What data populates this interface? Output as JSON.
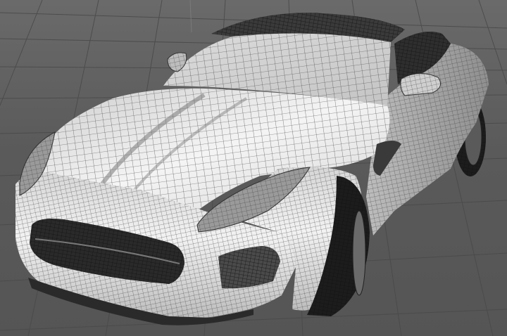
{
  "viewport": {
    "background_color": "#5d5d5d",
    "grid_color": "#474747",
    "mesh_line_color": "#3a3a3a",
    "surface_light": "#efefef",
    "surface_dark": "#9a9a9a",
    "glass_color": "#2e2e2e",
    "tyre_color": "#1c1c1c"
  },
  "scene": {
    "object": "car-wireframe-model",
    "view": "perspective",
    "display_mode": "shaded-wireframe"
  }
}
